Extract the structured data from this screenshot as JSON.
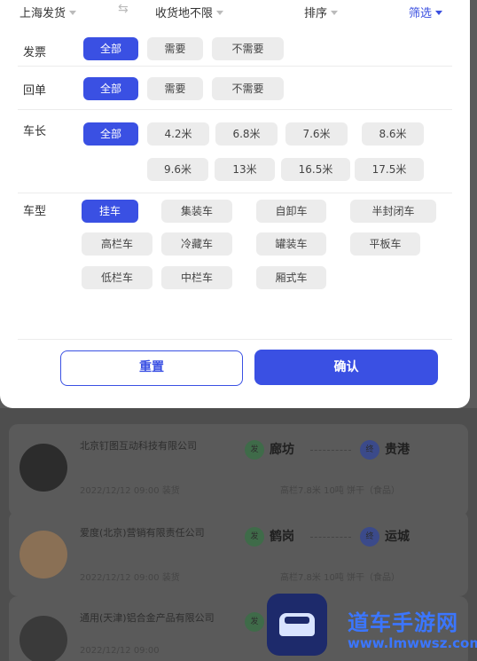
{
  "topbar": {
    "origin": "上海发货",
    "destination": "收货地不限",
    "sort": "排序",
    "filter": "筛选"
  },
  "invoice": {
    "label": "发票",
    "options": [
      "全部",
      "需要",
      "不需要"
    ]
  },
  "receipt": {
    "label": "回单",
    "options": [
      "全部",
      "需要",
      "不需要"
    ]
  },
  "length": {
    "label": "车长",
    "options": [
      "全部",
      "4.2米",
      "6.8米",
      "7.6米",
      "8.6米",
      "9.6米",
      "13米",
      "16.5米",
      "17.5米"
    ]
  },
  "truck_type": {
    "label": "车型",
    "options": [
      "挂车",
      "集装车",
      "自卸车",
      "半封闭车",
      "高栏车",
      "冷藏车",
      "罐装车",
      "平板车",
      "低栏车",
      "中栏车",
      "厢式车"
    ]
  },
  "actions": {
    "reset": "重置",
    "confirm": "确认"
  },
  "list": [
    {
      "company": "北京钉图互动科技有限公司",
      "from_badge": "发",
      "from": "廊坊",
      "to_badge": "终",
      "to": "贵港",
      "meta": "2022/12/12  09:00 装货",
      "detail": "高栏7.8米 10吨 饼干（食品）"
    },
    {
      "company": "爱度(北京)营销有限责任公司",
      "from_badge": "发",
      "from": "鹤岗",
      "to_badge": "终",
      "to": "运城",
      "meta": "2022/12/12  09:00 装货",
      "detail": "高栏7.8米 10吨 饼干（食品）"
    },
    {
      "company": "通用(天津)铝合金产品有限公司",
      "from_badge": "发",
      "from": "",
      "to_badge": "",
      "to": "",
      "meta": "2022/12/12  09:00",
      "detail": ""
    }
  ],
  "watermark": {
    "title": "道车手游网",
    "url": "www.lmwwsz.com"
  },
  "colors": {
    "accent": "#3a50e3",
    "chip_bg": "#ececec",
    "overlay": "#5b5b5b"
  }
}
